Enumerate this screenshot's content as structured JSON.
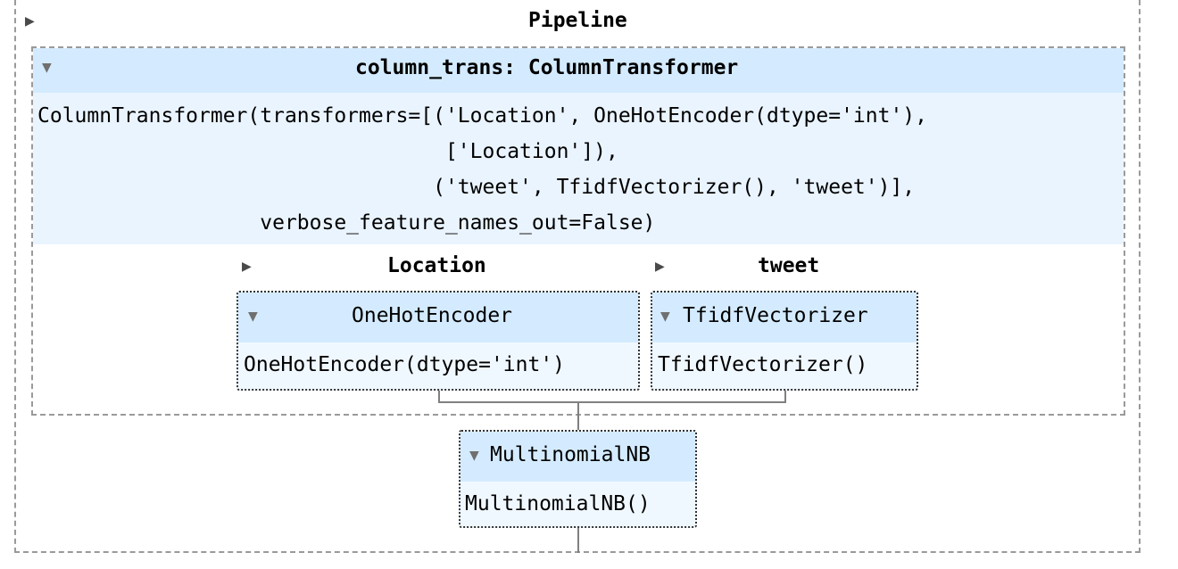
{
  "pipeline": {
    "title": "Pipeline"
  },
  "column_transformer": {
    "title": "column_trans: ColumnTransformer",
    "code_lines": [
      "ColumnTransformer(transformers=[('Location', OneHotEncoder(dtype='int'),",
      "                                 ['Location']),",
      "                                ('tweet', TfidfVectorizer(), 'tweet')],",
      "                  verbose_feature_names_out=False)"
    ]
  },
  "location_branch": {
    "label": "Location",
    "estimator_title": "OneHotEncoder",
    "estimator_repr": "OneHotEncoder(dtype='int')"
  },
  "tweet_branch": {
    "label": "tweet",
    "estimator_title": "TfidfVectorizer",
    "estimator_repr": "TfidfVectorizer()"
  },
  "classifier": {
    "title": "MultinomialNB",
    "repr": "MultinomialNB()"
  },
  "colors": {
    "header_bg": "#d4ebff",
    "box_bg": "#f0f8ff",
    "border": "#9a9a9a"
  }
}
